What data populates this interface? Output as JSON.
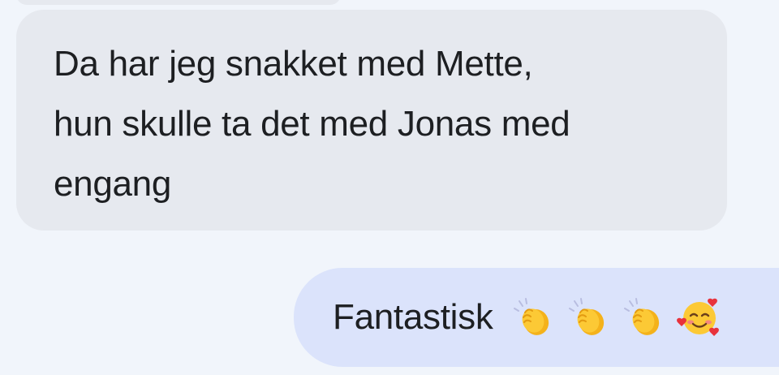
{
  "messages": [
    {
      "direction": "incoming",
      "lines": [
        "Da har jeg snakket med Mette,",
        "hun skulle ta det med Jonas med",
        "engang"
      ]
    },
    {
      "direction": "outgoing",
      "text": "Fantastisk",
      "emoji": [
        "clapping-hands",
        "clapping-hands",
        "clapping-hands",
        "smiling-face-with-hearts"
      ]
    }
  ],
  "colors": {
    "background": "#f1f5fb",
    "incoming_bubble": "#e6e9ef",
    "outgoing_bubble": "#dbe3fb",
    "text": "#1d1f22"
  }
}
